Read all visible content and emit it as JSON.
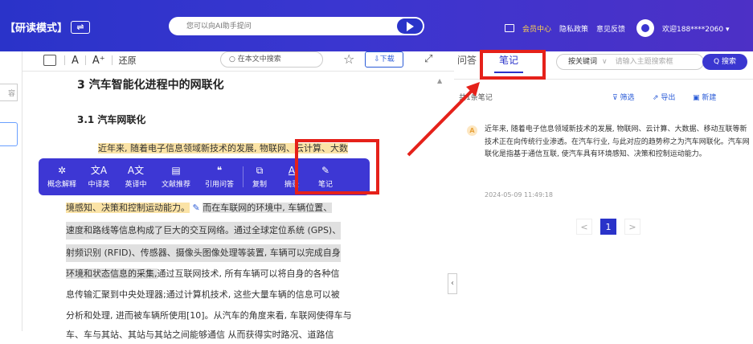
{
  "header": {
    "mode_label": "【研读模式】",
    "swap_icon": "⇌",
    "ai_placeholder": "您可以向AI助手提问",
    "links": [
      "会员中心",
      "隐私政策",
      "意见反馈"
    ],
    "user": "欢迎188****2060 ▾",
    "colors": {
      "brand": "#3a36d0",
      "vip": "#ffd34d",
      "highlight_red": "#e5211a"
    }
  },
  "left_strip": {
    "tab_label": "容"
  },
  "toolbar": {
    "font_decrease": "A",
    "font_increase": "A⁺",
    "reset": "还原",
    "search_placeholder": "在本文中搜索",
    "download": "下载"
  },
  "document": {
    "section_title": "3 汽车智能化进程中的网联化",
    "subsection_title": "3.1 汽车网联化",
    "lines": [
      "近年来, 随着电子信息领域新技术的发展, 物联网、云计算、大数",
      "境感知、决策和控制运动能力。",
      "而在车联网的环境中, 车辆位置、",
      "速度和路线等信息构成了巨大的交互网络。通过全球定位系统 (GPS)、",
      "射频识别 (RFID)、传感器、摄像头图像处理等装置, 车辆可以完成自身",
      "环境和状态信息的采集,",
      "通过互联网技术, 所有车辆可以将自身的各种信",
      "息传输汇聚到中央处理器;通过计算机技术, 这些大量车辆的信息可以被",
      "分析和处理, 进而被车辆所使用[10]。从汽车的角度来看, 车联网使得车与",
      "车、车与其站、其站与其站之间能够通信 从而获得实时路况、道路信"
    ]
  },
  "popup_menu": {
    "items": [
      {
        "label": "概念解释",
        "icon": "concept-icon",
        "glyph": "✲"
      },
      {
        "label": "中译英",
        "icon": "translate-zh-en-icon",
        "glyph": "文A"
      },
      {
        "label": "英译中",
        "icon": "translate-en-zh-icon",
        "glyph": "A文"
      },
      {
        "label": "文献推荐",
        "icon": "document-icon",
        "glyph": "▤"
      },
      {
        "label": "引用问答",
        "icon": "quote-icon",
        "glyph": "❝"
      },
      {
        "label": "复制",
        "icon": "copy-icon",
        "glyph": "⧉"
      },
      {
        "label": "摘录",
        "icon": "excerpt-icon",
        "glyph": "A"
      },
      {
        "label": "笔记",
        "icon": "pencil-icon",
        "glyph": "✎"
      }
    ]
  },
  "right_panel": {
    "tabs": [
      "问答",
      "笔记"
    ],
    "active_tab": "笔记",
    "keyword_select": "按关键词",
    "keyword_placeholder": "请输入主题搜索框",
    "search_button": "Q 搜索",
    "notes_count": "共1条笔记",
    "actions": [
      "筛选",
      "导出",
      "新建"
    ],
    "note": {
      "badge": "A",
      "text": "近年来, 随着电子信息领域新技术的发展, 物联网、云计算、大数据、移动互联等新技术正在向传统行业渗透。在汽车行业, 与此对应的趋势称之为汽车网联化。汽车网联化是指基于通信互联, 使汽车具有环境感知、决策和控制运动能力。",
      "time": "2024-05-09 11:49:18"
    },
    "pagination": {
      "prev": "<",
      "current": "1",
      "next": ">"
    }
  }
}
